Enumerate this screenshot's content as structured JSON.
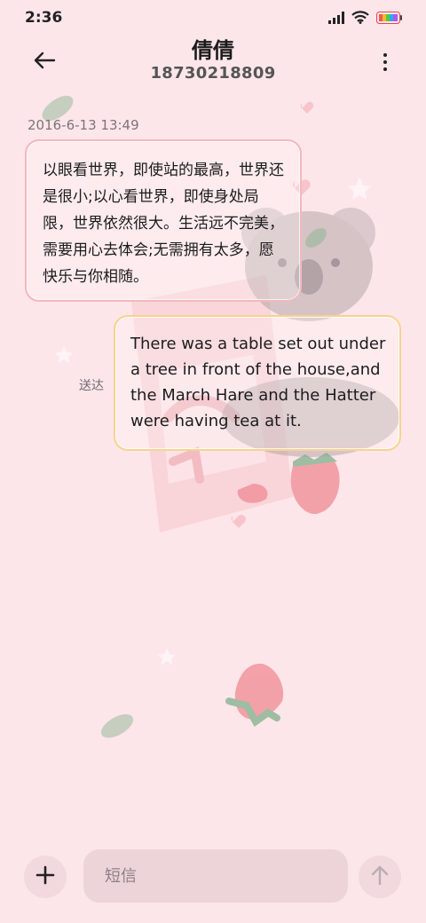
{
  "status_bar": {
    "time": "2:36",
    "icons": [
      "signal-icon",
      "wifi-icon",
      "battery-icon"
    ]
  },
  "header": {
    "contact_name": "倩倩",
    "contact_number": "18730218809",
    "back_icon": "back-arrow-icon",
    "more_icon": "more-vertical-icon"
  },
  "messages": [
    {
      "direction": "incoming",
      "timestamp": "2016-6-13 13:49",
      "text": "以眼看世界，即使站的最高，世界还是很小;以心看世界，即使身处局限，世界依然很大。生活远不完美，需要用心去体会;无需拥有太多，愿快乐与你相随。"
    },
    {
      "direction": "outgoing",
      "status": "送达",
      "text": "There was a table set out under a tree in front of the house,and the March Hare and the Hatter were having tea at it."
    }
  ],
  "composer": {
    "placeholder": "短信",
    "add_icon": "plus-icon",
    "send_icon": "send-arrow-icon"
  },
  "colors": {
    "background": "#fde6ea",
    "incoming_border": "#f2b8bd",
    "outgoing_border": "#f6d38e"
  }
}
